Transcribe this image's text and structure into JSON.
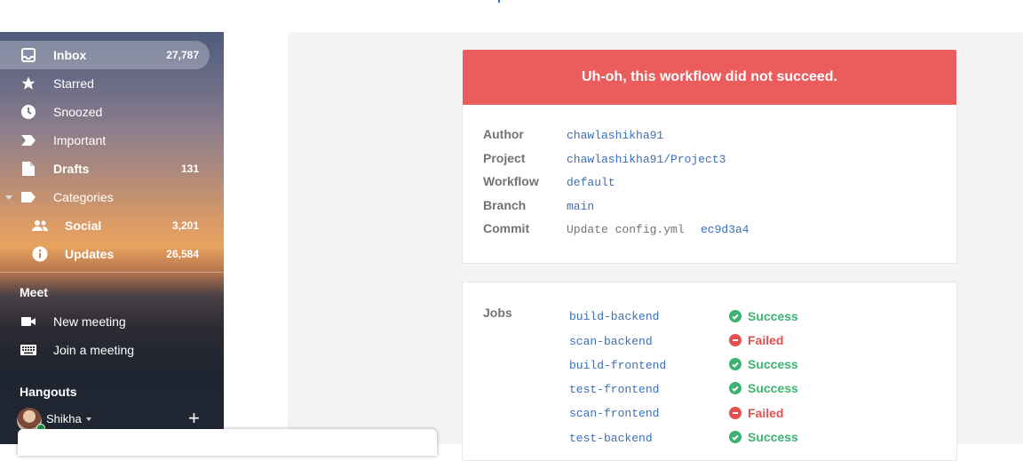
{
  "sidebar": {
    "items": [
      {
        "label": "Inbox",
        "count": "27,787",
        "icon": "inbox-icon"
      },
      {
        "label": "Starred",
        "count": "",
        "icon": "star-icon"
      },
      {
        "label": "Snoozed",
        "count": "",
        "icon": "clock-icon"
      },
      {
        "label": "Important",
        "count": "",
        "icon": "important-icon"
      },
      {
        "label": "Drafts",
        "count": "131",
        "icon": "draft-icon"
      },
      {
        "label": "Categories",
        "count": "",
        "icon": "label-icon"
      },
      {
        "label": "Social",
        "count": "3,201",
        "icon": "people-icon"
      },
      {
        "label": "Updates",
        "count": "26,584",
        "icon": "info-icon"
      }
    ],
    "meet": {
      "title": "Meet",
      "new_meeting": "New meeting",
      "join_meeting": "Join a meeting"
    },
    "hangouts": {
      "title": "Hangouts",
      "user": "Shikha"
    }
  },
  "email": {
    "banner": "Uh-oh, this workflow did not succeed.",
    "details": {
      "author_label": "Author",
      "author": "chawlashikha91",
      "project_label": "Project",
      "project": "chawlashikha91/Project3",
      "workflow_label": "Workflow",
      "workflow": "default",
      "branch_label": "Branch",
      "branch": "main",
      "commit_label": "Commit",
      "commit_message": "Update config.yml",
      "commit_hash": "ec9d3a4"
    },
    "jobs_label": "Jobs",
    "jobs": [
      {
        "name": "build-backend",
        "status": "Success"
      },
      {
        "name": "scan-backend",
        "status": "Failed"
      },
      {
        "name": "build-frontend",
        "status": "Success"
      },
      {
        "name": "test-frontend",
        "status": "Success"
      },
      {
        "name": "scan-frontend",
        "status": "Failed"
      },
      {
        "name": "test-backend",
        "status": "Success"
      }
    ],
    "colors": {
      "banner": "#eb5c5c",
      "success": "#3cb371",
      "failed": "#e2504f",
      "link": "#3b6fb6"
    }
  }
}
